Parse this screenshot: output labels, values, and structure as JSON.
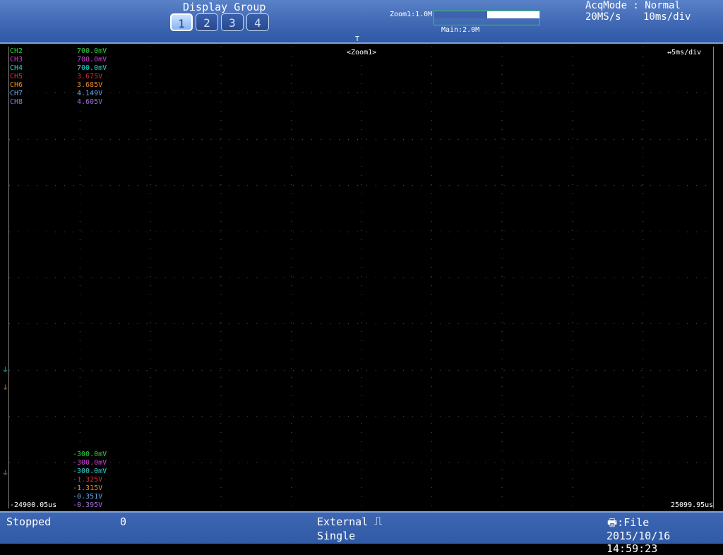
{
  "header": {
    "display_group_title": "Display Group",
    "display_groups": [
      "1",
      "2",
      "3",
      "4"
    ],
    "active_group": "1",
    "zoom1_label": "Zoom1:1.0M",
    "main_label": "Main:2.0M",
    "zoom_fraction": 0.5,
    "acq_mode": "AcqMode : Normal",
    "sample_rate": "20MS/s",
    "time_div": "10ms/div",
    "trigger_marker": "T"
  },
  "scope": {
    "zoom_tag": "<Zoom1>",
    "zoom_time_div": "↔5ms/div",
    "time_left": "-24900.05us",
    "time_right": "25099.95us"
  },
  "channels": [
    {
      "name": "CH2",
      "top": "700.0mV",
      "bottom": "-300.0mV",
      "color": "#2fd23f"
    },
    {
      "name": "CH3",
      "top": "700.0mV",
      "bottom": "-300.0mV",
      "color": "#d040d8"
    },
    {
      "name": "CH4",
      "top": "700.0mV",
      "bottom": "-300.0mV",
      "color": "#28d4d4"
    },
    {
      "name": "CH5",
      "top": "3.675V",
      "bottom": "-1.325V",
      "color": "#e03030"
    },
    {
      "name": "CH6",
      "top": "3.685V",
      "bottom": "-1.315V",
      "color": "#e88a2a"
    },
    {
      "name": "CH7",
      "top": "4.149V",
      "bottom": "-0.351V",
      "color": "#6aa6e8"
    },
    {
      "name": "CH8",
      "top": "4.605V",
      "bottom": "-0.395V",
      "color": "#a070d8"
    }
  ],
  "ground_markers": [
    {
      "symbol": "⏚",
      "color": "#28d4d4"
    },
    {
      "symbol": "⏚",
      "color": "#e88a2a"
    },
    {
      "symbol": "⏚",
      "color": "#a070d8"
    }
  ],
  "footer": {
    "state": "Stopped",
    "count": "0",
    "trigger_source": "External",
    "trigger_edge": "⎍",
    "trigger_mode": "Single",
    "save_target": "🖶:File",
    "clock": "2015/10/16 14:59:23"
  }
}
